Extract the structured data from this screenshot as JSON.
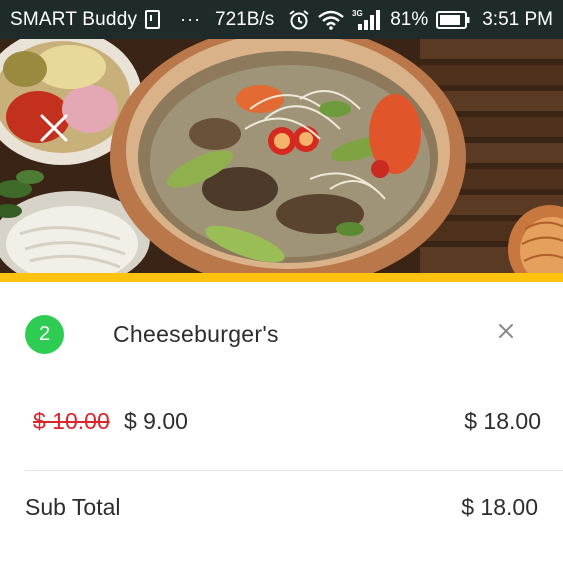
{
  "status_bar": {
    "carrier": "SMART Buddy",
    "dots": "···",
    "network_speed": "721B/s",
    "signal_label": "3G",
    "battery": "81%",
    "time": "3:51 PM",
    "icons": [
      "sim-icon",
      "alarm-icon",
      "wifi-icon",
      "signal-icon",
      "battery-icon"
    ]
  },
  "hero": {
    "close_icon": "close-icon",
    "accent_color": "#ffc20e"
  },
  "cart_item": {
    "quantity": "2",
    "name": "Cheeseburger's",
    "original_price": "$ 10.00",
    "price": "$ 9.00",
    "line_total": "$ 18.00",
    "remove_icon": "close-icon",
    "badge_color": "#2ecc52",
    "strike_color": "#d9262c"
  },
  "summary": {
    "subtotal_label": "Sub Total",
    "subtotal_value": "$ 18.00"
  }
}
